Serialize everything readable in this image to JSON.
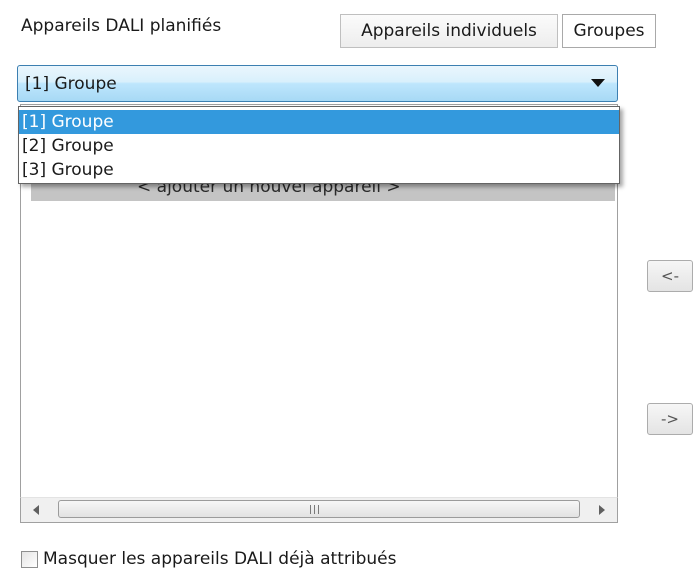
{
  "header": {
    "title": "Appareils DALI planifiés"
  },
  "tabs": [
    {
      "label": "Appareils individuels",
      "selected": false
    },
    {
      "label": "Groupes",
      "selected": true
    }
  ],
  "combo": {
    "value": "[1] Groupe",
    "options": [
      "[1] Groupe",
      "[2] Groupe",
      "[3] Groupe"
    ],
    "highlighted_index": 0
  },
  "list": {
    "add_item_label": "< ajouter un nouvel appareil >"
  },
  "scrollbar": {
    "grip_icon": "grip-lines-icon"
  },
  "side_buttons": {
    "left_label": "<-",
    "right_label": "->"
  },
  "checkbox": {
    "label": "Masquer les appareils DALI déjà attribués",
    "checked": false
  },
  "colors": {
    "selection": "#3399dd",
    "combo_border": "#3c7fb1",
    "add_row_bg": "#c4c4c4"
  }
}
